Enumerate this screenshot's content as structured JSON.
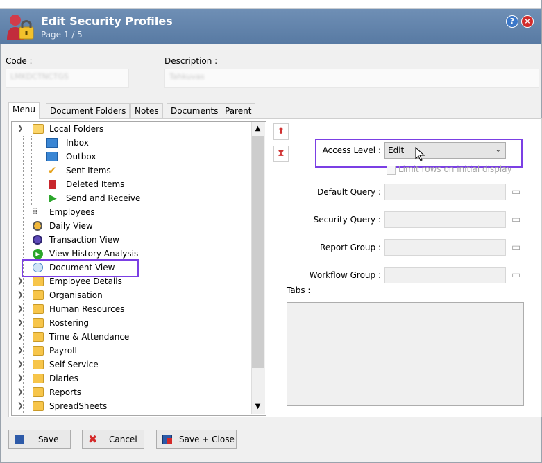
{
  "window": {
    "title": "Edit Security Profiles",
    "page_info": "Page 1 / 5",
    "help_label": "?",
    "close_label": "×"
  },
  "header": {
    "code_label": "Code :",
    "code_value": "LMKDCTNCTGS",
    "description_label": "Description :",
    "description_value": "Tahkuvas"
  },
  "tabs": [
    "Menu",
    "Document Folders",
    "Notes",
    "Documents",
    "Parent"
  ],
  "tree": [
    {
      "label": "Local Folders",
      "icon": "folder-open-icon"
    },
    {
      "label": "Inbox",
      "icon": "inbox-icon"
    },
    {
      "label": "Outbox",
      "icon": "outbox-icon"
    },
    {
      "label": "Sent Items",
      "icon": "checkmark-icon"
    },
    {
      "label": "Deleted Items",
      "icon": "trash-icon"
    },
    {
      "label": "Send and Receive",
      "icon": "play-icon"
    },
    {
      "label": "Employees",
      "icon": "grid-dots-icon"
    },
    {
      "label": "Daily View",
      "icon": "daily-view-icon"
    },
    {
      "label": "Transaction View",
      "icon": "transaction-view-icon"
    },
    {
      "label": "View History Analysis",
      "icon": "play-circle-icon"
    },
    {
      "label": "Document View",
      "icon": "document-view-icon"
    },
    {
      "label": "Employee Details",
      "icon": "folder-icon"
    },
    {
      "label": "Organisation",
      "icon": "folder-icon"
    },
    {
      "label": "Human Resources",
      "icon": "folder-icon"
    },
    {
      "label": "Rostering",
      "icon": "folder-icon"
    },
    {
      "label": "Time & Attendance",
      "icon": "folder-icon"
    },
    {
      "label": "Payroll",
      "icon": "folder-icon"
    },
    {
      "label": "Self-Service",
      "icon": "folder-icon"
    },
    {
      "label": "Diaries",
      "icon": "folder-icon"
    },
    {
      "label": "Reports",
      "icon": "folder-icon"
    },
    {
      "label": "SpreadSheets",
      "icon": "folder-icon"
    }
  ],
  "properties": {
    "access_level_label": "Access Level :",
    "access_level_value": "Edit",
    "limit_rows_label": "Limit rows on initial display",
    "default_query_label": "Default Query :",
    "security_query_label": "Security Query :",
    "report_group_label": "Report Group :",
    "workflow_group_label": "Workflow Group :",
    "tabs_label": "Tabs :"
  },
  "buttons": {
    "save": "Save",
    "cancel": "Cancel",
    "save_close": "Save + Close"
  },
  "colors": {
    "highlight": "#7b3fe4",
    "title_bar": "#6483ad"
  }
}
